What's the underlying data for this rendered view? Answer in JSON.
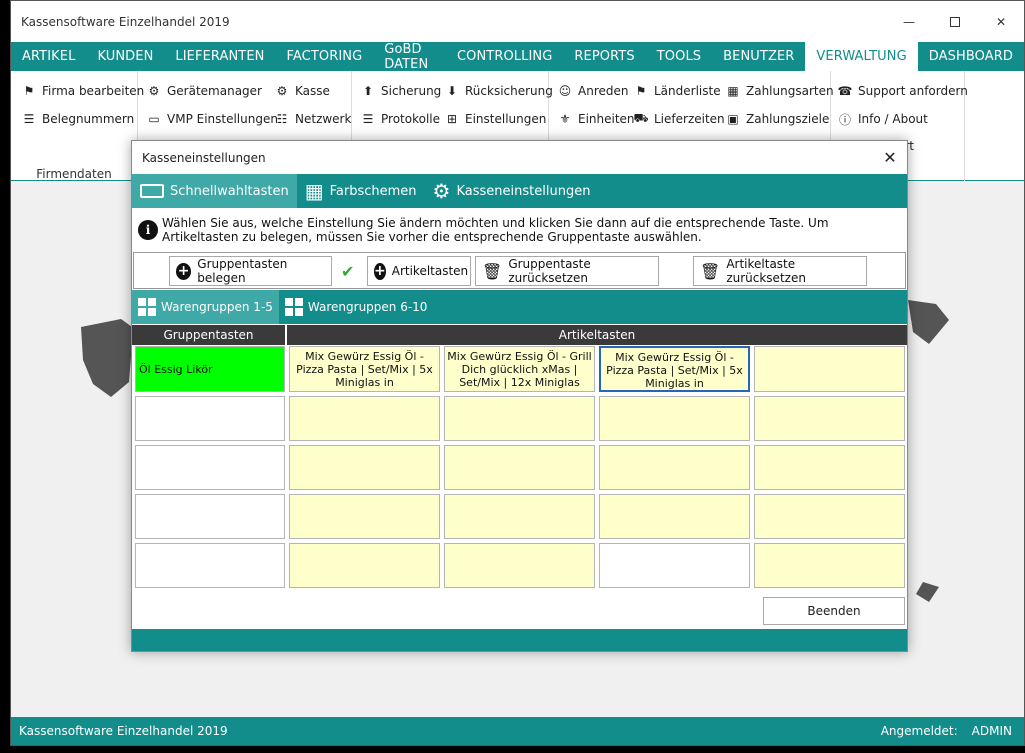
{
  "window": {
    "title": "Kassensoftware  Einzelhandel  2019"
  },
  "menu": [
    "ARTIKEL",
    "KUNDEN",
    "LIEFERANTEN",
    "FACTORING",
    "GoBD DATEN",
    "CONTROLLING",
    "REPORTS",
    "TOOLS",
    "BENUTZER",
    "VERWALTUNG",
    "DASHBOARD"
  ],
  "menu_active": "VERWALTUNG",
  "ribbon": {
    "firma_bearbeiten": "Firma bearbeiten",
    "belegnummern": "Belegnummern",
    "firmendaten": "Firmendaten",
    "geraetemanager": "Gerätemanager",
    "kasse": "Kasse",
    "vmp": "VMP Einstellungen",
    "netzwerk": "Netzwerk",
    "sicherung": "Sicherung",
    "ruecksicherung": "Rücksicherung",
    "protokolle": "Protokolle",
    "einstellungen": "Einstellungen",
    "anreden": "Anreden",
    "laenderliste": "Länderliste",
    "zahlungsarten": "Zahlungsarten",
    "einheiten": "Einheiten",
    "lieferzeiten": "Lieferzeiten",
    "zahlungsziele": "Zahlungsziele",
    "support": "Support anfordern",
    "info": "Info / About",
    "partial": "ort"
  },
  "status": {
    "app": "Kassensoftware  Einzelhandel  2019",
    "user_label": "Angemeldet:",
    "user": "ADMIN"
  },
  "dialog": {
    "title": "Kasseneinstellungen",
    "tabs": [
      "Schnellwahltasten",
      "Farbschemen",
      "Kasseneinstellungen"
    ],
    "info": "Wählen Sie aus, welche Einstellung Sie ändern möchten und klicken Sie dann auf die entsprechende Taste. Um Artikeltasten zu belegen, müssen Sie  vorher die entsprechende Gruppentaste auswählen.",
    "toolbar": {
      "gruppe": "Gruppentasten belegen",
      "artikel": "Artikeltasten",
      "gruppe_reset": "Gruppentaste zurücksetzen",
      "artikel_reset": "Artikeltaste zurücksetzen"
    },
    "group_tabs": [
      "Warengruppen 1-5",
      "Warengruppen 6-10"
    ],
    "headers": {
      "gruppen": "Gruppentasten",
      "artikel": "Artikeltasten"
    },
    "groups": [
      "Öl Essig Likör",
      "",
      "",
      "",
      ""
    ],
    "articles": [
      [
        "Mix Gewürz Essig Öl - Pizza  Pasta | Set/Mix | 5x Miniglas in",
        "Mix Gewürz Essig Öl - Grill Dich glücklich xMas | Set/Mix | 12x Miniglas",
        "Mix Gewürz Essig Öl - Pizza  Pasta | Set/Mix | 5x Miniglas in",
        ""
      ],
      [
        "",
        "",
        "",
        ""
      ],
      [
        "",
        "",
        "",
        ""
      ],
      [
        "",
        "",
        "",
        ""
      ],
      [
        "",
        "",
        "",
        ""
      ]
    ],
    "close": "Beenden"
  }
}
